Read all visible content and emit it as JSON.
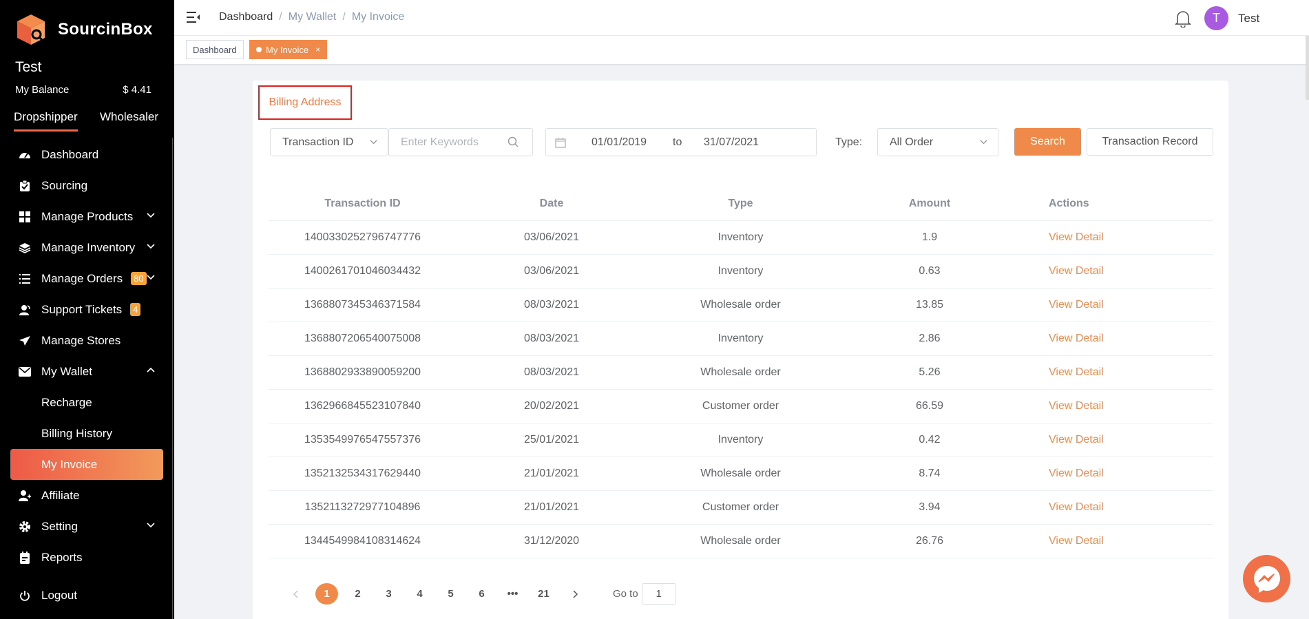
{
  "brand": {
    "name": "SourcinBox"
  },
  "user": {
    "name": "Test",
    "balance_label": "My Balance",
    "balance_value": "$ 4.41"
  },
  "role_tabs": [
    "Dropshipper",
    "Wholesaler"
  ],
  "menu": {
    "dashboard": "Dashboard",
    "sourcing": "Sourcing",
    "manage_products": "Manage Products",
    "manage_inventory": "Manage Inventory",
    "manage_orders": "Manage Orders",
    "manage_orders_badge": "80",
    "support_tickets": "Support Tickets",
    "support_tickets_badge": "4",
    "manage_stores": "Manage Stores",
    "my_wallet": "My Wallet",
    "recharge": "Recharge",
    "billing_history": "Billing History",
    "my_invoice": "My Invoice",
    "affiliate": "Affiliate",
    "setting": "Setting",
    "reports": "Reports",
    "logout": "Logout"
  },
  "header": {
    "breadcrumb": [
      "Dashboard",
      "My Wallet",
      "My Invoice"
    ],
    "avatar_letter": "T",
    "user_name": "Test"
  },
  "tags": {
    "dashboard": "Dashboard",
    "active": "My Invoice",
    "close": "×"
  },
  "billing_button": "Billing Address",
  "filters": {
    "id_select": "Transaction ID",
    "keyword_placeholder": "Enter Keywords",
    "date_from": "01/01/2019",
    "date_to_label": "to",
    "date_to": "31/07/2021",
    "type_label": "Type:",
    "type_select": "All Order",
    "search_button": "Search",
    "record_button": "Transaction Record"
  },
  "table": {
    "headers": [
      "Transaction ID",
      "Date",
      "Type",
      "Amount",
      "Actions"
    ],
    "rows": [
      [
        "1400330252796747776",
        "03/06/2021",
        "Inventory",
        "1.9",
        "View Detail"
      ],
      [
        "1400261701046034432",
        "03/06/2021",
        "Inventory",
        "0.63",
        "View Detail"
      ],
      [
        "1368807345346371584",
        "08/03/2021",
        "Wholesale order",
        "13.85",
        "View Detail"
      ],
      [
        "1368807206540075008",
        "08/03/2021",
        "Inventory",
        "2.86",
        "View Detail"
      ],
      [
        "1368802933890059200",
        "08/03/2021",
        "Wholesale order",
        "5.26",
        "View Detail"
      ],
      [
        "1362966845523107840",
        "20/02/2021",
        "Customer order",
        "66.59",
        "View Detail"
      ],
      [
        "1353549976547557376",
        "25/01/2021",
        "Inventory",
        "0.42",
        "View Detail"
      ],
      [
        "1352132534317629440",
        "21/01/2021",
        "Wholesale order",
        "8.74",
        "View Detail"
      ],
      [
        "1352113272977104896",
        "21/01/2021",
        "Customer order",
        "3.94",
        "View Detail"
      ],
      [
        "1344549984108314624",
        "31/12/2020",
        "Wholesale order",
        "26.76",
        "View Detail"
      ]
    ]
  },
  "pagination": {
    "pages": [
      "1",
      "2",
      "3",
      "4",
      "5",
      "6",
      "•••",
      "21"
    ],
    "current": "1",
    "goto_label": "Go to",
    "goto_value": "1"
  },
  "colors": {
    "accent": "#f08a4b",
    "sidebar_bg": "#000000",
    "active_gradient_start": "#ee5a47",
    "highlight_border": "#e02020"
  }
}
